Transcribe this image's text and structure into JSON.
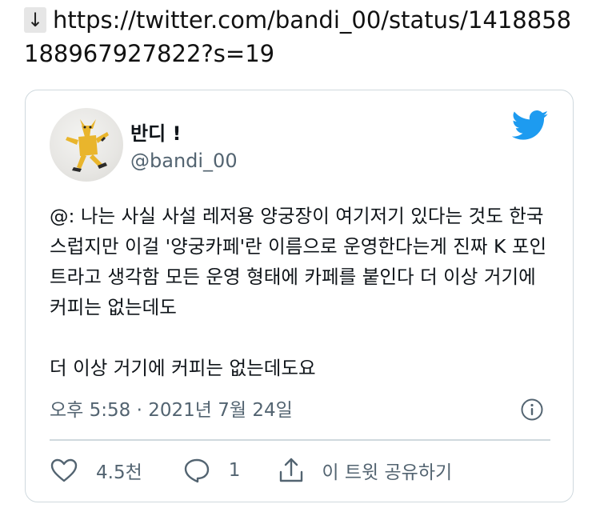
{
  "link": {
    "icon": "down-arrow-icon",
    "url": "https://twitter.com/bandi_00/status/1418858188967927822?s=19"
  },
  "tweet": {
    "display_name": "반디 !",
    "handle": "@bandi_00",
    "text_paragraph_1": "@: 나는 사실 사설 레저용 양궁장이 여기저기 있다는 것도 한국스럽지만 이걸 '양궁카페'란 이름으로 운영한다는게 진짜 K 포인트라고 생각함 모든 운영 형태에 카페를 붙인다 더 이상 거기에 커피는 없는데도",
    "text_paragraph_2": "더 이상 거기에 커피는 없는데도요",
    "timestamp": "오후 5:58 · 2021년 7월 24일"
  },
  "actions": {
    "like_count": "4.5천",
    "reply_count": "1",
    "share_label": "이 트윗 공유하기"
  },
  "colors": {
    "twitter_blue": "#1d9bf0",
    "secondary_text": "#536471",
    "border": "#cfd9de",
    "avatar_figure": "#e9b52c"
  }
}
